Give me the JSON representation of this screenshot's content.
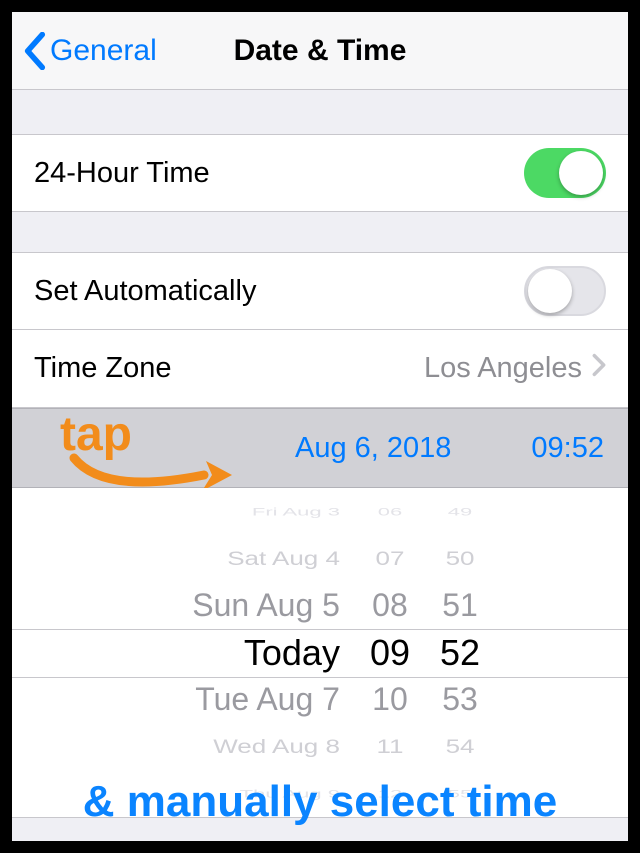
{
  "nav": {
    "back_label": "General",
    "title": "Date & Time"
  },
  "rows": {
    "hour24_label": "24-Hour Time",
    "hour24_on": "true",
    "set_auto_label": "Set Automatically",
    "set_auto_on": "false",
    "timezone_label": "Time Zone",
    "timezone_value": "Los Angeles"
  },
  "selected": {
    "date": "Aug 6, 2018",
    "time": "09:52"
  },
  "picker": {
    "dates": [
      "Fri Aug 3",
      "Sat Aug 4",
      "Sun Aug 5",
      "Today",
      "Tue Aug 7",
      "Wed Aug 8",
      "Thu Aug 9"
    ],
    "hours": [
      "06",
      "07",
      "08",
      "09",
      "10",
      "11",
      "12"
    ],
    "minutes": [
      "49",
      "50",
      "51",
      "52",
      "53",
      "54",
      "55"
    ]
  },
  "annotation": {
    "tap": "tap",
    "bottom": "& manually select time"
  },
  "colors": {
    "accent": "#007aff",
    "toggle_on": "#4cd964",
    "annotation_orange": "#f28c1b"
  }
}
